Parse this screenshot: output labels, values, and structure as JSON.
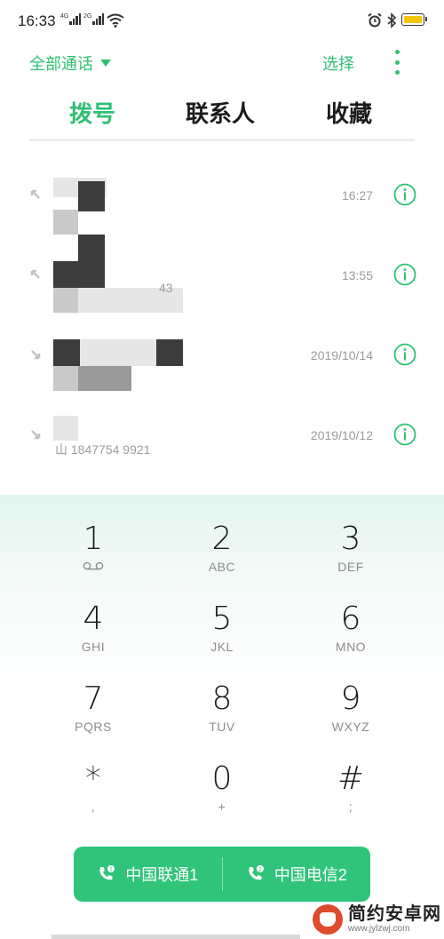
{
  "status_bar": {
    "time": "16:33",
    "network1": "4G",
    "network2": "2G"
  },
  "header": {
    "filter_label": "全部通话",
    "select_label": "选择"
  },
  "tabs": [
    {
      "label": "拨号",
      "active": true
    },
    {
      "label": "联系人",
      "active": false
    },
    {
      "label": "收藏",
      "active": false
    }
  ],
  "call_log": [
    {
      "number_fragment": "",
      "time": "16:27",
      "direction": "outgoing"
    },
    {
      "number_fragment": "43",
      "time": "13:55",
      "direction": "outgoing"
    },
    {
      "number_fragment": "",
      "time": "2019/10/14",
      "direction": "incoming"
    },
    {
      "number_fragment": "山 1847754 9921",
      "time": "2019/10/12",
      "direction": "incoming"
    }
  ],
  "dialpad": [
    {
      "digit": "1",
      "letters": ""
    },
    {
      "digit": "2",
      "letters": "ABC"
    },
    {
      "digit": "3",
      "letters": "DEF"
    },
    {
      "digit": "4",
      "letters": "GHI"
    },
    {
      "digit": "5",
      "letters": "JKL"
    },
    {
      "digit": "6",
      "letters": "MNO"
    },
    {
      "digit": "7",
      "letters": "PQRS"
    },
    {
      "digit": "8",
      "letters": "TUV"
    },
    {
      "digit": "9",
      "letters": "WXYZ"
    },
    {
      "digit": "*",
      "letters": ","
    },
    {
      "digit": "0",
      "letters": "+"
    },
    {
      "digit": "#",
      "letters": ";"
    }
  ],
  "sim_buttons": [
    {
      "label": "中国联通1",
      "sim": "1"
    },
    {
      "label": "中国电信2",
      "sim": "2"
    }
  ],
  "watermark": {
    "title": "简约安卓网",
    "url": "www.jylzwj.com"
  },
  "colors": {
    "accent": "#2fbf74",
    "sim_bar": "#2fc47a",
    "battery": "#f3c500"
  }
}
